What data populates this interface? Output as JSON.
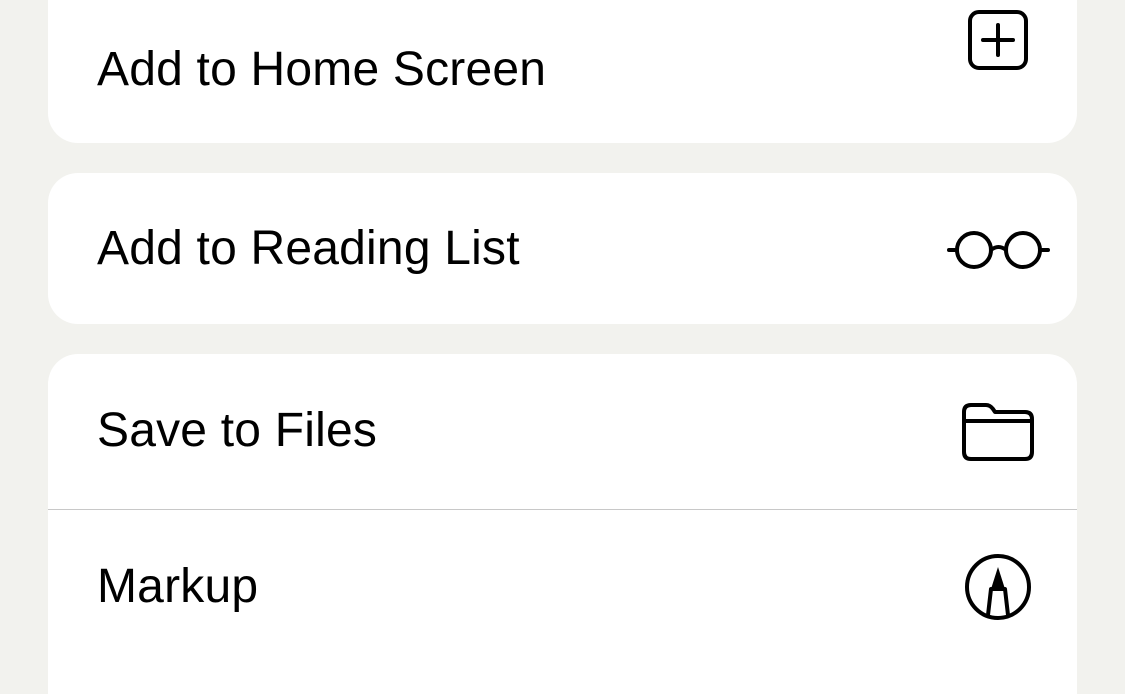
{
  "share_sheet": {
    "actions": [
      {
        "label": "Add to Home Screen",
        "icon": "plus-square-icon"
      },
      {
        "label": "Add to Reading List",
        "icon": "glasses-icon"
      },
      {
        "label": "Save to Files",
        "icon": "folder-icon"
      },
      {
        "label": "Markup",
        "icon": "markup-pen-icon"
      }
    ]
  },
  "colors": {
    "background": "#f2f2ee",
    "card": "#ffffff",
    "text": "#000000",
    "divider": "#c8c8c8"
  }
}
